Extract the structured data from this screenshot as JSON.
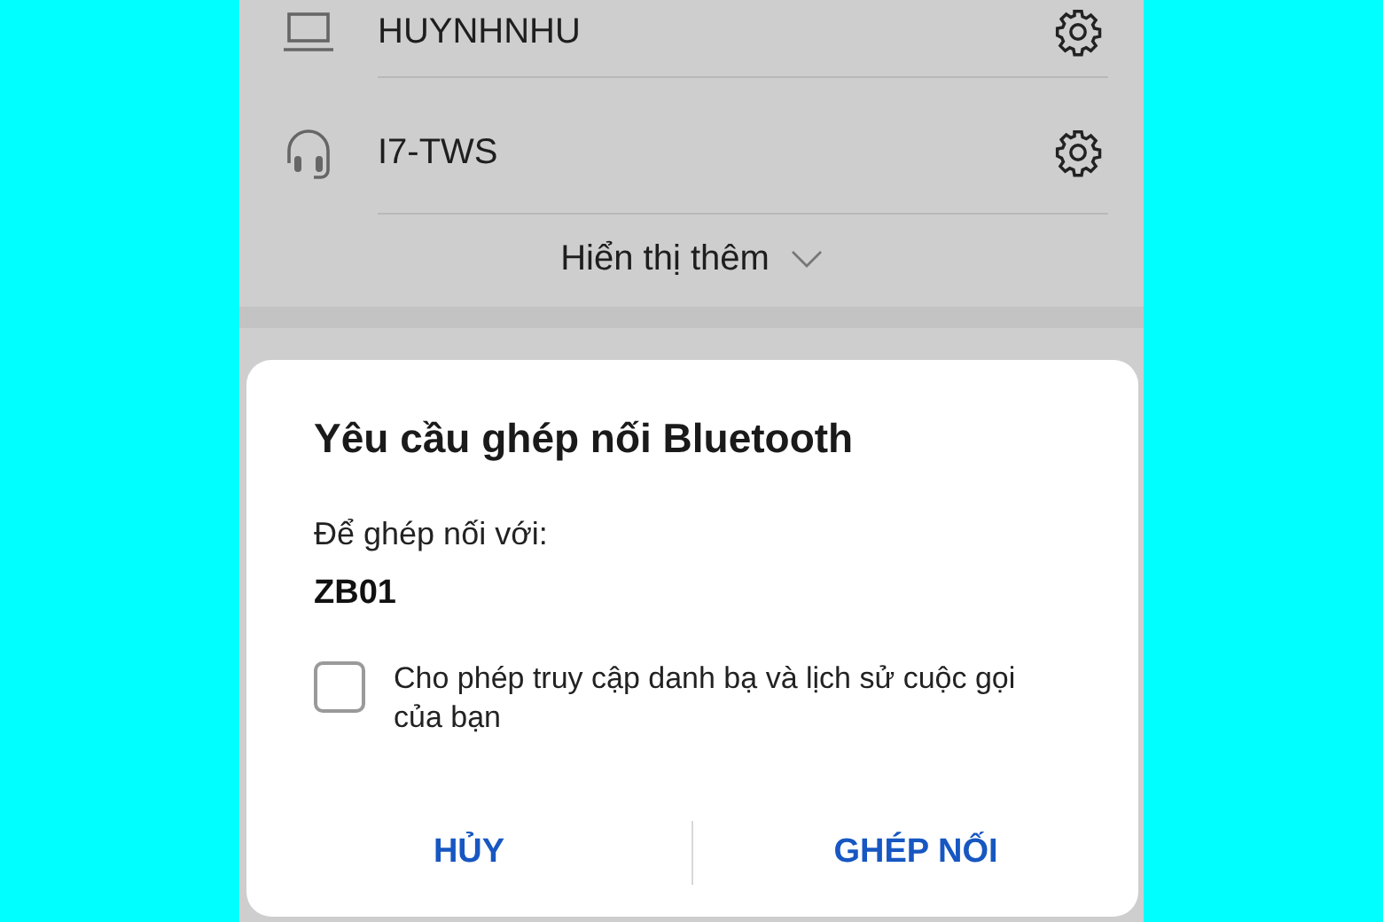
{
  "devices": [
    {
      "name": "HUYNHNHU",
      "kind": "laptop"
    },
    {
      "name": "I7-TWS",
      "kind": "headset"
    }
  ],
  "show_more": "Hiển thị thêm",
  "dialog": {
    "title": "Yêu cầu ghép nối Bluetooth",
    "prompt": "Để ghép nối với:",
    "device_name": "ZB01",
    "checkbox": {
      "label": "Cho phép truy cập danh bạ và lịch sử cuộc gọi của bạn",
      "checked": false
    },
    "buttons": [
      "HỦY",
      "GHÉP NỐI"
    ]
  }
}
